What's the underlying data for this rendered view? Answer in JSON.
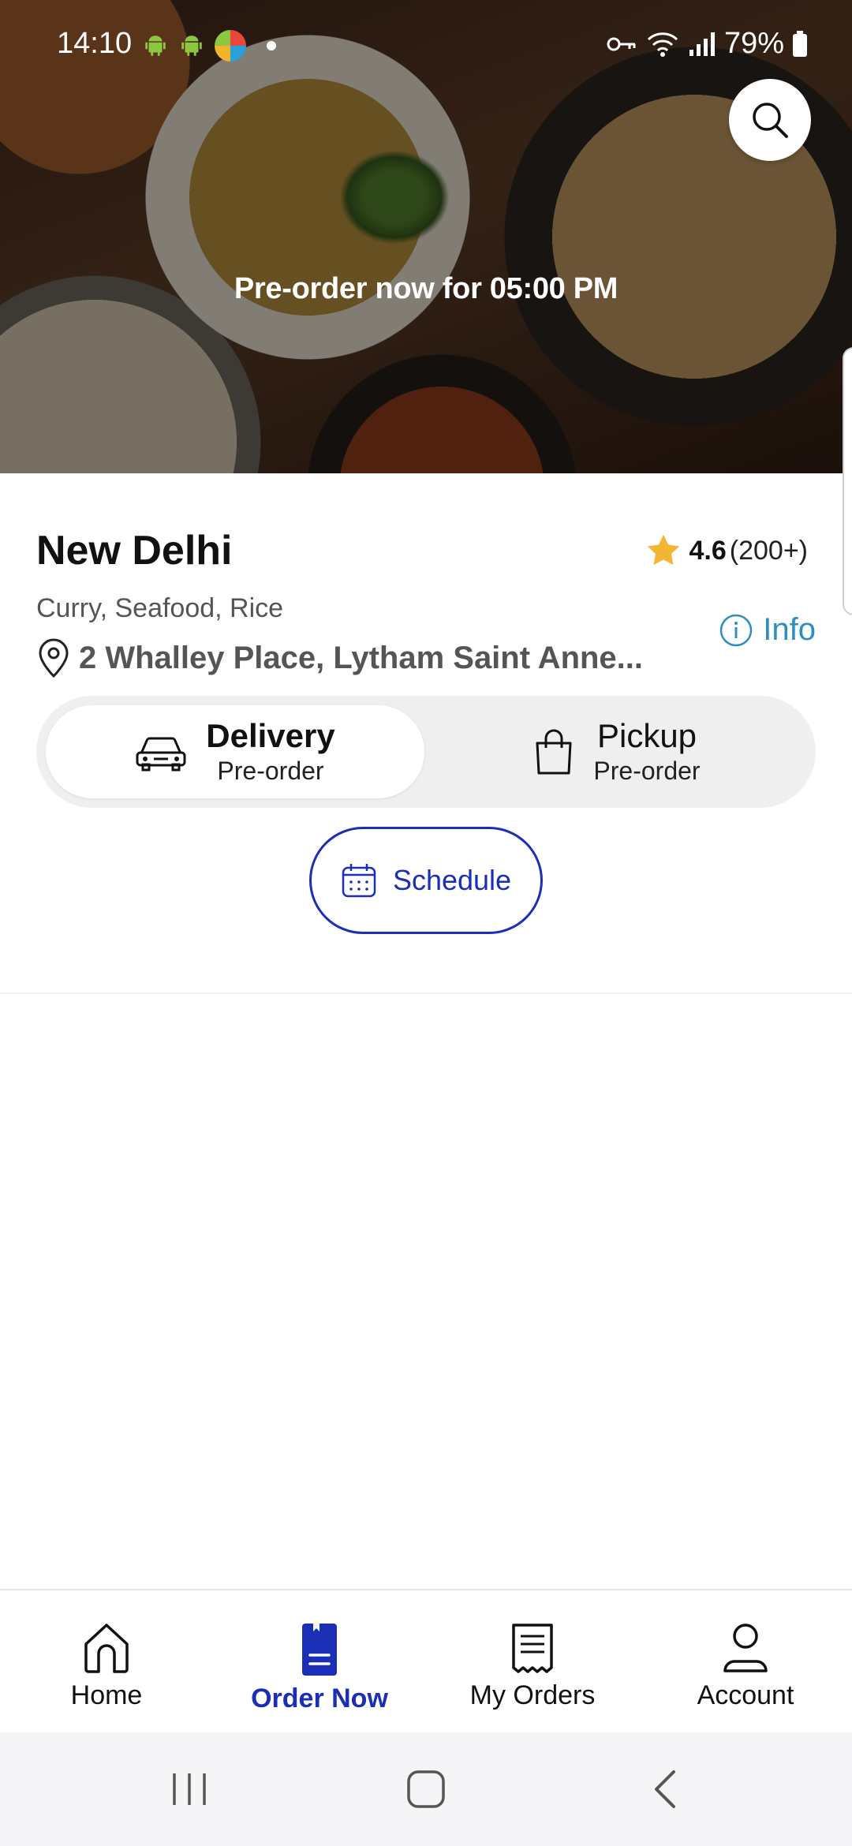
{
  "status_bar": {
    "time": "14:10",
    "battery": "79%"
  },
  "hero": {
    "banner": "Pre-order now for 05:00 PM"
  },
  "restaurant": {
    "name": "New Delhi",
    "rating": "4.6",
    "rating_count": "(200+)",
    "cuisines": "Curry, Seafood, Rice",
    "address": "2 Whalley Place, Lytham Saint Anne...",
    "info_label": "Info"
  },
  "order_mode": {
    "options": [
      {
        "label": "Delivery",
        "sub": "Pre-order",
        "icon": "car-icon",
        "selected": true
      },
      {
        "label": "Pickup",
        "sub": "Pre-order",
        "icon": "bag-icon",
        "selected": false
      }
    ]
  },
  "schedule": {
    "label": "Schedule"
  },
  "bottom_nav": {
    "items": [
      {
        "label": "Home",
        "icon": "home-icon"
      },
      {
        "label": "Order Now",
        "icon": "order-icon",
        "active": true
      },
      {
        "label": "My Orders",
        "icon": "receipt-icon"
      },
      {
        "label": "Account",
        "icon": "person-icon"
      }
    ]
  },
  "colors": {
    "accent": "#1a2fb5",
    "info": "#2d8fbf",
    "star": "#f2b632"
  }
}
